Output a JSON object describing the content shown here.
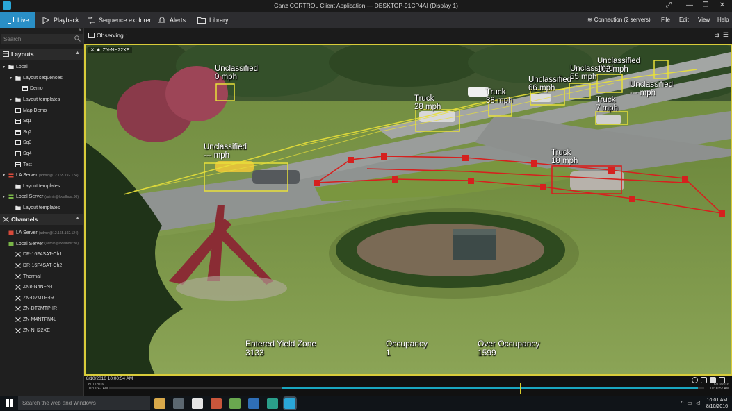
{
  "window": {
    "title": "Ganz CORTROL Client Application — DESKTOP-91CP4AI (Display 1)"
  },
  "nav": {
    "tabs": [
      {
        "label": "Live",
        "active": true,
        "icon": "monitor-icon"
      },
      {
        "label": "Playback",
        "icon": "play-icon"
      },
      {
        "label": "Sequence explorer",
        "icon": "sequence-icon"
      },
      {
        "label": "Alerts",
        "icon": "bell-icon"
      },
      {
        "label": "Library",
        "icon": "folder-icon"
      }
    ],
    "connection": "Connection (2 servers)",
    "menu": [
      "File",
      "Edit",
      "View",
      "Help"
    ]
  },
  "sidebar": {
    "search_placeholder": "Search",
    "layouts_header": "Layouts",
    "layouts": [
      {
        "label": "Local",
        "level": 0,
        "arrow": "▾",
        "icon": "folder"
      },
      {
        "label": "Layout sequences",
        "level": 1,
        "arrow": "▾",
        "icon": "folder"
      },
      {
        "label": "Demo",
        "level": 2,
        "arrow": "",
        "icon": "layout"
      },
      {
        "label": "Layout templates",
        "level": 1,
        "arrow": "▸",
        "icon": "folder"
      },
      {
        "label": "Map Demo",
        "level": 1,
        "arrow": "",
        "icon": "layout"
      },
      {
        "label": "Sq1",
        "level": 1,
        "arrow": "",
        "icon": "layout"
      },
      {
        "label": "Sq2",
        "level": 1,
        "arrow": "",
        "icon": "layout"
      },
      {
        "label": "Sq3",
        "level": 1,
        "arrow": "",
        "icon": "layout"
      },
      {
        "label": "Sq4",
        "level": 1,
        "arrow": "",
        "icon": "layout"
      },
      {
        "label": "Test",
        "level": 1,
        "arrow": "",
        "icon": "layout"
      },
      {
        "label": "LA Server",
        "sub": "(admin@12.165.192.124)",
        "level": 0,
        "arrow": "▾",
        "icon": "server-red"
      },
      {
        "label": "Layout templates",
        "level": 1,
        "arrow": "",
        "icon": "folder"
      },
      {
        "label": "Local Server",
        "sub": "(admin@localhost:80)",
        "level": 0,
        "arrow": "▾",
        "icon": "server-green"
      },
      {
        "label": "Layout templates",
        "level": 1,
        "arrow": "",
        "icon": "folder"
      }
    ],
    "channels_header": "Channels",
    "channels": [
      {
        "label": "LA Server",
        "sub": "(admin@12.165.192.124)",
        "level": 0,
        "icon": "server-red"
      },
      {
        "label": "Local Server",
        "sub": "(admin@localhost:80)",
        "level": 0,
        "icon": "server-green"
      },
      {
        "label": "DR-16F4SAT-Ch1",
        "level": 1,
        "icon": "camera"
      },
      {
        "label": "DR-16F4SAT-Ch2",
        "level": 1,
        "icon": "camera"
      },
      {
        "label": "Thermal",
        "level": 1,
        "icon": "camera"
      },
      {
        "label": "ZN8-N4NFN4",
        "level": 1,
        "icon": "camera"
      },
      {
        "label": "ZN-D2MTP-IR",
        "level": 1,
        "icon": "camera"
      },
      {
        "label": "ZN-DT2MTP-IR",
        "level": 1,
        "icon": "camera"
      },
      {
        "label": "ZN-M4NTFN4L",
        "level": 1,
        "icon": "camera"
      },
      {
        "label": "ZN-NH22XE",
        "level": 1,
        "icon": "camera"
      }
    ]
  },
  "toolbar": {
    "observing": "Observing"
  },
  "video": {
    "camera": "ZN-NH22XE",
    "labels": [
      {
        "line1": "Unclassified",
        "line2": "0 mph"
      },
      {
        "line1": "Unclassified",
        "line2": "--- mph"
      },
      {
        "line1": "Truck",
        "line2": "28 mph"
      },
      {
        "line1": "Truck",
        "line2": "38 mph"
      },
      {
        "line1": "Unclassified",
        "line2": "66 mph"
      },
      {
        "line1": "Unclassified",
        "line2": "55 mph"
      },
      {
        "line1": "Unclassified",
        "line2": "102 mph"
      },
      {
        "line1": "Unclassified",
        "line2": "--- mph"
      },
      {
        "line1": "Truck",
        "line2": "7 mph"
      },
      {
        "line1": "Truck",
        "line2": "18 mph"
      }
    ],
    "stats": [
      {
        "label": "Entered Yield Zone",
        "value": "3133"
      },
      {
        "label": "Occupancy",
        "value": "1"
      },
      {
        "label": "Over Occupancy",
        "value": "1599"
      }
    ]
  },
  "timeline": {
    "date": "8/10/2016",
    "time": "10:00:54 AM",
    "start_date": "8/10/2016",
    "start_time": "10:00:47 AM",
    "end_date": "8/10/2016",
    "end_time": "10:00:57 AM",
    "playhead": 0.69,
    "buffered_start": 0.29,
    "buffered_end": 0.99
  },
  "taskbar": {
    "search_placeholder": "Search the web and Windows",
    "time": "10:01 AM",
    "date": "8/10/2016"
  },
  "colors": {
    "accent": "#2a8fc6",
    "zone": "#d6201e",
    "track": "#e8e03a",
    "frame": "#d9cc3a",
    "timeline": "#1aa6c0"
  }
}
